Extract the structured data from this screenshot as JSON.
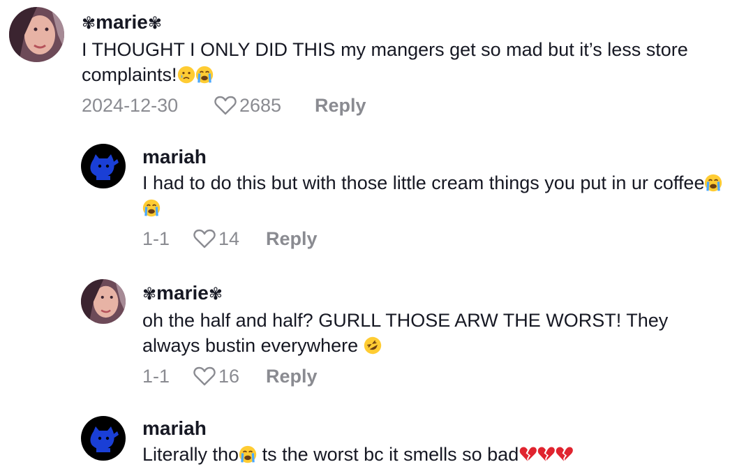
{
  "comments": [
    {
      "username": "marie",
      "text_before": "I THOUGHT I ONLY DID THIS my mangers get so mad but it’s less store complaints!",
      "text_after": "",
      "date": "2024-12-30",
      "likes": "2685",
      "reply_label": "Reply"
    },
    {
      "username": "mariah",
      "text_before": "I had to do this but with those little cream things you put in ur coffee",
      "text_after": "",
      "date": "1-1",
      "likes": "14",
      "reply_label": "Reply"
    },
    {
      "username": "marie",
      "text_before": "oh the half and half? GURLL THOSE ARW THE WORST! They always bustin everywhere ",
      "text_after": "",
      "date": "1-1",
      "likes": "16",
      "reply_label": "Reply"
    },
    {
      "username": "mariah",
      "text_before": "Literally tho",
      "text_after": " ts the worst bc it smells so bad",
      "date": "",
      "likes": "",
      "reply_label": ""
    }
  ],
  "icons": {
    "username_decoration": "sprig-icon",
    "like": "heart-outline-icon",
    "emoji_sad_tear": "sad-tear-emoji",
    "emoji_loud_crying": "loudly-crying-emoji",
    "emoji_rofl": "rolling-laughing-emoji",
    "emoji_broken_heart": "broken-heart-emoji"
  },
  "colors": {
    "text": "#161823",
    "muted": "#8a8b91"
  }
}
